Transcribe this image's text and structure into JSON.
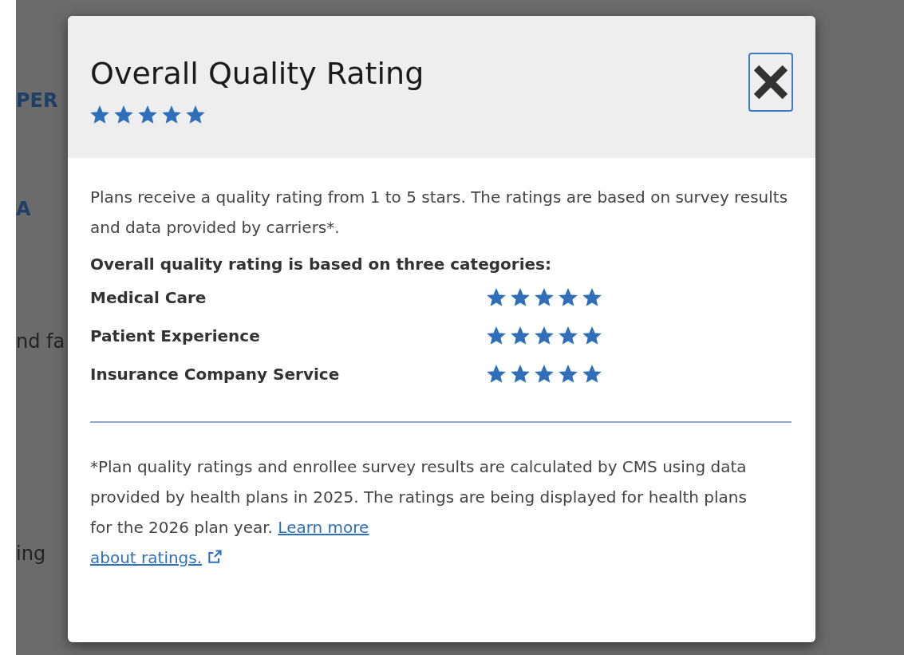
{
  "background": {
    "fragments": [
      {
        "text": "PER",
        "kind": "link"
      },
      {
        "text": "A",
        "kind": "link"
      },
      {
        "text": "nd fa",
        "kind": "text"
      },
      {
        "text": "ing",
        "kind": "text"
      }
    ]
  },
  "dialog": {
    "title": "Overall Quality Rating",
    "stars": 5,
    "intro": "Plans receive a quality rating from 1 to 5 stars. The ratings are based on survey results and data provided by carriers*.",
    "categories_heading": "Overall quality rating is based on three categories:",
    "categories": [
      {
        "name": "Medical Care",
        "stars": 5
      },
      {
        "name": "Patient Experience",
        "stars": 5
      },
      {
        "name": "Insurance Company Service",
        "stars": 5
      }
    ],
    "footnote": "*Plan quality ratings and enrollee survey results are calculated by CMS using data provided by health plans in 2025. The ratings are being displayed for health plans for the 2026 plan year.",
    "link_lines": [
      "Learn more",
      "about ratings."
    ]
  }
}
